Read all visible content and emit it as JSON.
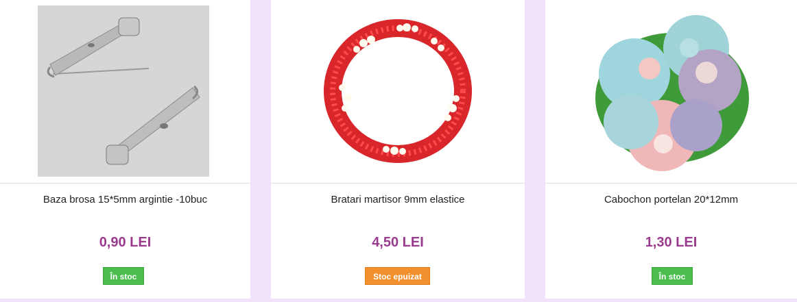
{
  "products": [
    {
      "name": "Baza brosa 15*5mm argintie -10buc",
      "price": "0,90 LEI",
      "stock": "În stoc",
      "image": "brooch-pin-image"
    },
    {
      "name": "Bratari martisor 9mm elastice",
      "price": "4,50 LEI",
      "stock": "Stoc epuizat",
      "image": "beaded-bracelet-image"
    },
    {
      "name": "Cabochon portelan 20*12mm",
      "price": "1,30 LEI",
      "stock": "În stoc",
      "image": "porcelain-roses-cabochon-image"
    }
  ],
  "colors": {
    "price": "#993a8c",
    "in_stock": "#4cbe4f",
    "out_of_stock": "#f3902e",
    "background": "#f1e3fb"
  }
}
